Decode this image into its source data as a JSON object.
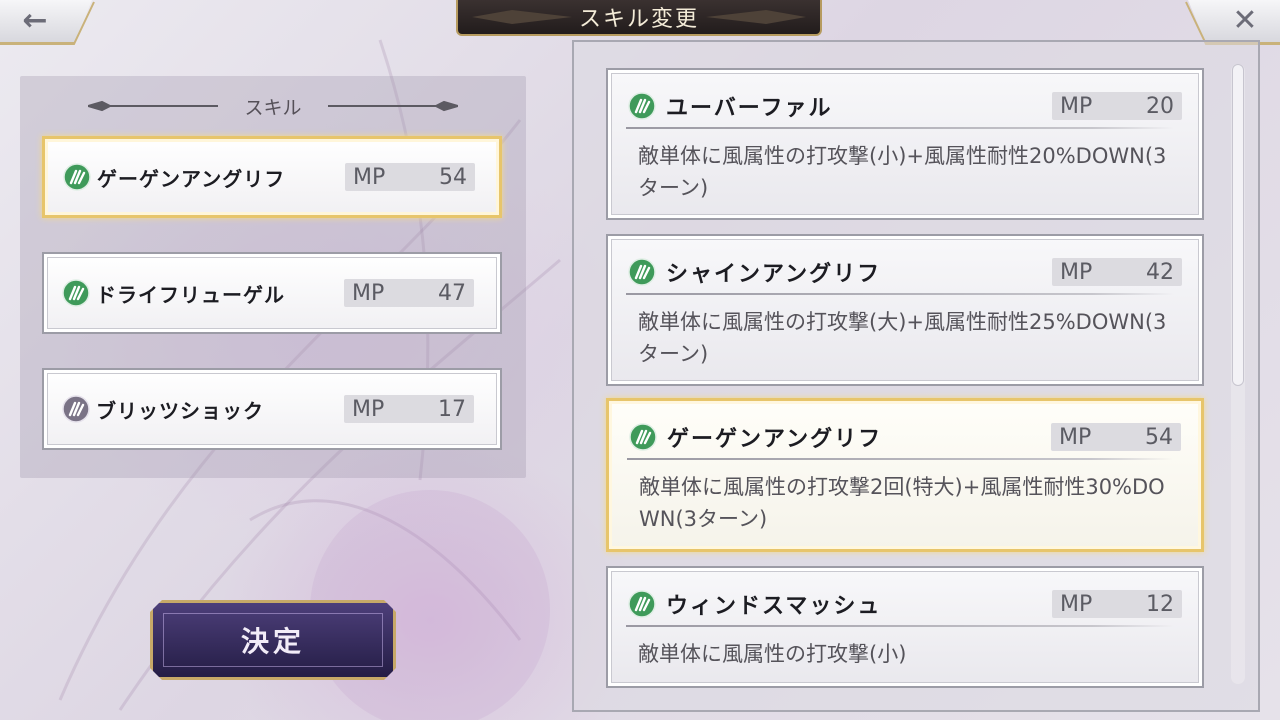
{
  "header": {
    "title": "スキル変更",
    "back_icon": "arrow-left-icon",
    "close_icon": "close-x-icon"
  },
  "equipped": {
    "heading": "スキル",
    "slots": [
      {
        "name": "ゲーゲンアングリフ",
        "mp_label": "MP",
        "mp": "54",
        "icon": "wind-element-icon",
        "selected": true
      },
      {
        "name": "ドライフリューゲル",
        "mp_label": "MP",
        "mp": "47",
        "icon": "wind-element-icon",
        "selected": false
      },
      {
        "name": "ブリッツショック",
        "mp_label": "MP",
        "mp": "17",
        "icon": "lightning-element-icon",
        "selected": false
      }
    ]
  },
  "decide_button": {
    "label": "決定"
  },
  "skill_list": [
    {
      "name": "ユーバーファル",
      "mp_label": "MP",
      "mp": "20",
      "description": "敵単体に風属性の打攻撃(小)+風属性耐性20%DOWN(3ターン)",
      "icon": "wind-element-icon",
      "selected": false
    },
    {
      "name": "シャインアングリフ",
      "mp_label": "MP",
      "mp": "42",
      "description": "敵単体に風属性の打攻撃(大)+風属性耐性25%DOWN(3ターン)",
      "icon": "wind-element-icon",
      "selected": false
    },
    {
      "name": "ゲーゲンアングリフ",
      "mp_label": "MP",
      "mp": "54",
      "description": "敵単体に風属性の打攻撃2回(特大)+風属性耐性30%DOWN(3ターン)",
      "icon": "wind-element-icon",
      "selected": true
    },
    {
      "name": "ウィンドスマッシュ",
      "mp_label": "MP",
      "mp": "12",
      "description": "敵単体に風属性の打攻撃(小)",
      "icon": "wind-element-icon",
      "selected": false
    }
  ],
  "colors": {
    "wind_element": "#3f9a5a",
    "lightning_element": "#7a7386",
    "selection_gold": "#e7c56b",
    "decide_purple": "#3a2f66"
  }
}
